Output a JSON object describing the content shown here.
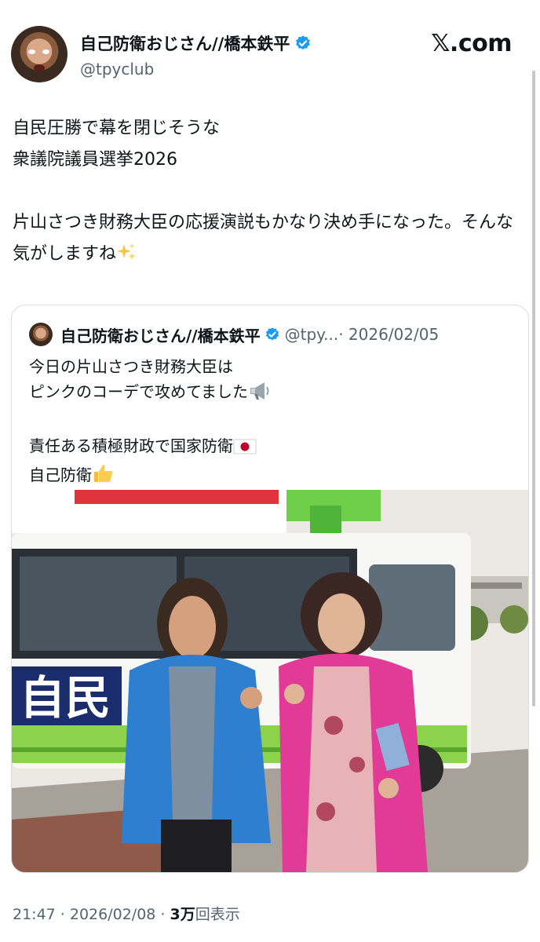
{
  "brand": "𝕏.com",
  "author": {
    "name": "自己防衛おじさん//橋本鉄平",
    "handle": "@tpyclub",
    "verified": true
  },
  "tweet": {
    "text": "自民圧勝で幕を閉じそうな\n衆議院議員選挙2026\n\n片山さつき財務大臣の応援演説もかなり決め手になった。そんな気がしますね",
    "emoji_name": "sparkles-icon",
    "timestamp": "21:47 · 2026/02/08 · ",
    "views_count": "3万",
    "views_label": "回表示"
  },
  "quoted": {
    "name": "自己防衛おじさん//橋本鉄平",
    "handle": "@tpy...",
    "date": " · 2026/02/05",
    "line1": "今日の片山さつき財務大臣は",
    "line2": "ピンクのコーデで攻めてました",
    "line3": "責任ある積極財政で国家防衛",
    "line4": "自己防衛",
    "image_alt": "photo of two people giving thumbs up in front of a campaign bus",
    "bus_text": "自民"
  },
  "colors": {
    "verified": "#1d9bf0",
    "secondary_text": "#536471",
    "bus_green": "#8bd34a",
    "jacket_blue": "#2f7fd0",
    "coat_pink": "#e23b97"
  }
}
